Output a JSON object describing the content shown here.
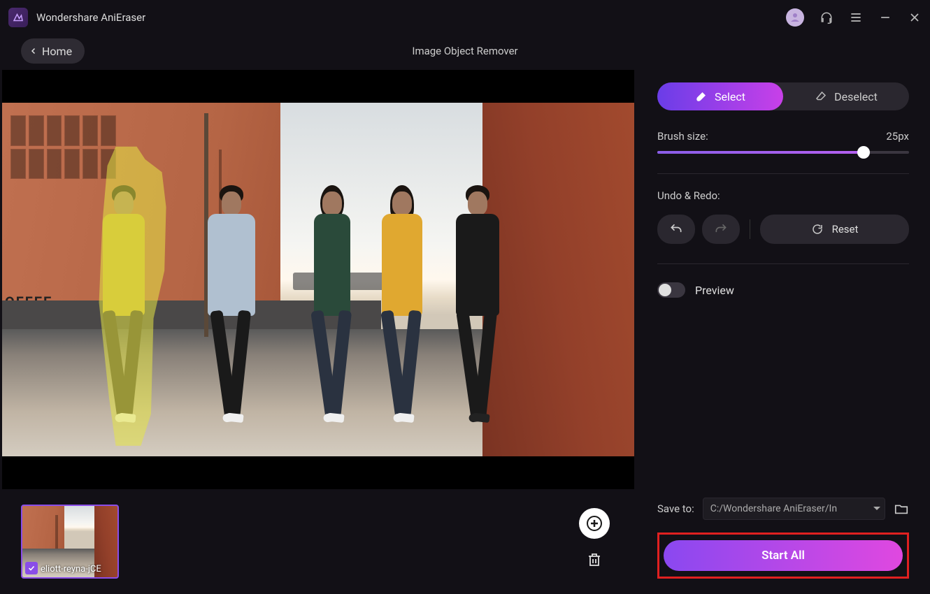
{
  "app": {
    "title": "Wondershare AniEraser"
  },
  "nav": {
    "home": "Home",
    "page_title": "Image Object Remover"
  },
  "thumb": {
    "filename": "eliott-reyna-jCE"
  },
  "side": {
    "select": "Select",
    "deselect": "Deselect",
    "brush_label": "Brush size:",
    "brush_value": "25px",
    "undo_redo_label": "Undo & Redo:",
    "reset": "Reset",
    "preview": "Preview",
    "save_label": "Save to:",
    "save_path": "C:/Wondershare AniEraser/In",
    "start": "Start All"
  }
}
